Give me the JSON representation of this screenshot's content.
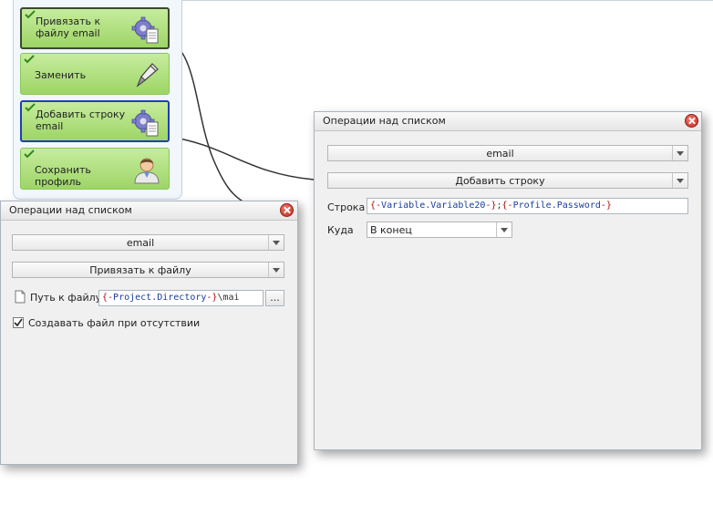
{
  "nodes": [
    {
      "label": "Привязать к файлу email",
      "icon": "gear-document-icon"
    },
    {
      "label": "Заменить",
      "icon": "pen-icon"
    },
    {
      "label": "Добавить строку email",
      "icon": "gear-document-icon"
    },
    {
      "label": "Сохранить профиль",
      "icon": "user-profile-icon"
    }
  ],
  "left_panel": {
    "title": "Операции над списком",
    "list_select": "email",
    "operation_select": "Привязать к файлу",
    "path_label": "Путь к файлу",
    "path_value": {
      "open": "{-",
      "name": "Project.Directory",
      "close": "-}",
      "rest": "\\mai"
    },
    "browse_label": "...",
    "create_checkbox_label": "Создавать файл при отсутствии",
    "create_checkbox_checked": true
  },
  "right_panel": {
    "title": "Операции над списком",
    "list_select": "email",
    "operation_select": "Добавить строку",
    "line_label": "Строка",
    "line_value": {
      "open1": "{-",
      "name1": "Variable.Variable20",
      "close1": "-}",
      "sep": ";",
      "open2": "{-",
      "name2": "Profile.Password",
      "close2": "-}"
    },
    "where_label": "Куда",
    "where_select": "В конец"
  },
  "colors": {
    "node_fill": "#9ed566",
    "node_border": "#8bc65a",
    "selected_dark": "#3a4a2e",
    "selected_blue": "#1f3fb3",
    "close_red": "#c8241c",
    "macro_brace": "#b01010",
    "macro_name": "#1a3c9c"
  }
}
